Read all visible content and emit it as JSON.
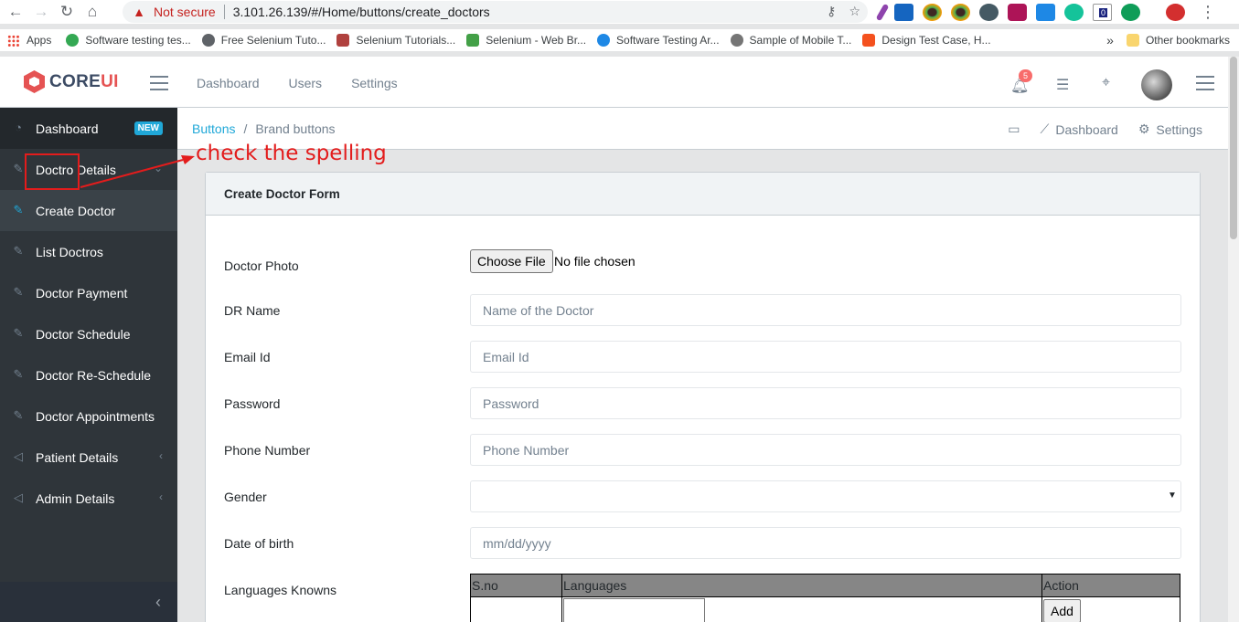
{
  "browser": {
    "security_label": "Not secure",
    "url": "3.101.26.139/#/Home/buttons/create_doctors",
    "ext_badge": "0",
    "bookmarks": [
      {
        "label": "Apps",
        "color": "#ea4335"
      },
      {
        "label": "Software testing tes...",
        "color": "#34a853"
      },
      {
        "label": "Free Selenium Tuto...",
        "color": "#5f6368"
      },
      {
        "label": "Selenium Tutorials...",
        "color": "#b0413e"
      },
      {
        "label": "Selenium - Web Br...",
        "color": "#43a047"
      },
      {
        "label": "Software Testing Ar...",
        "color": "#1e88e5"
      },
      {
        "label": "Sample of Mobile T...",
        "color": "#757575"
      },
      {
        "label": "Design Test Case, H...",
        "color": "#f4511e"
      }
    ],
    "more_label": "»",
    "other_bookmarks": "Other bookmarks"
  },
  "header": {
    "brand_core": "CORE",
    "brand_ui": "UI",
    "nav": [
      "Dashboard",
      "Users",
      "Settings"
    ],
    "notification_count": "5"
  },
  "sidebar": {
    "items": [
      {
        "label": "Dashboard",
        "badge": "NEW"
      },
      {
        "label": "Doctro Details"
      },
      {
        "label": "Create Doctor"
      },
      {
        "label": "List Doctros"
      },
      {
        "label": "Doctor Payment"
      },
      {
        "label": "Doctor Schedule"
      },
      {
        "label": "Doctor Re-Schedule"
      },
      {
        "label": "Doctor Appointments"
      },
      {
        "label": "Patient Details"
      },
      {
        "label": "Admin Details"
      }
    ]
  },
  "breadcrumb": {
    "link": "Buttons",
    "separator": "/",
    "current": "Brand buttons",
    "menu_dashboard": "Dashboard",
    "menu_settings": "Settings"
  },
  "form": {
    "title": "Create Doctor Form",
    "photo_label": "Doctor Photo",
    "file_button": "Choose File",
    "file_status": "No file chosen",
    "name_label": "DR Name",
    "name_placeholder": "Name of the Doctor",
    "email_label": "Email Id",
    "email_placeholder": "Email Id",
    "password_label": "Password",
    "password_placeholder": "Password",
    "phone_label": "Phone Number",
    "phone_placeholder": "Phone Number",
    "gender_label": "Gender",
    "dob_label": "Date of birth",
    "dob_placeholder": "mm/dd/yyyy",
    "languages_label": "Languages Knowns",
    "table_headers": [
      "S.no",
      "Languages",
      "Action"
    ],
    "add_button": "Add"
  },
  "annotation": {
    "text": "check the spelling",
    "color": "#e31c1c"
  }
}
